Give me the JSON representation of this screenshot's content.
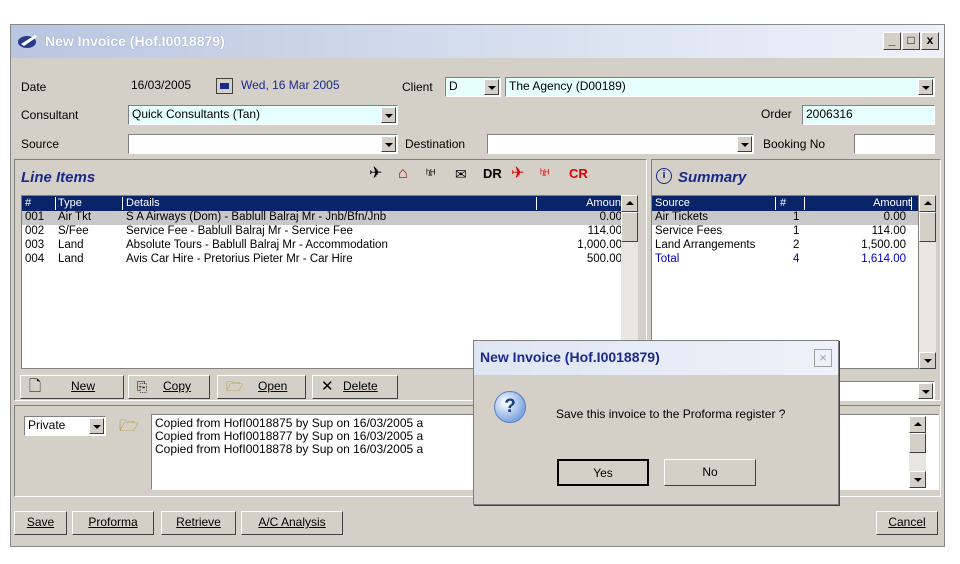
{
  "window": {
    "title": "New Invoice (Hof.I0018879)",
    "min_label": "_",
    "max_label": "□",
    "close_label": "x"
  },
  "form": {
    "date_label": "Date",
    "date_value": "16/03/2005",
    "date_long": "Wed, 16 Mar 2005",
    "client_label": "Client",
    "client_code": "D",
    "client_name": "The Agency (D00189)",
    "consultant_label": "Consultant",
    "consultant_value": "Quick Consultants (Tan)",
    "order_label": "Order",
    "order_value": "2006316",
    "source_label": "Source",
    "source_value": "",
    "destination_label": "Destination",
    "destination_value": "",
    "booking_label": "Booking No",
    "booking_value": ""
  },
  "line_items": {
    "title": "Line Items",
    "toolbar_labels": {
      "dr": "DR",
      "cr": "CR"
    },
    "columns": [
      "#",
      "Type",
      "Details",
      "Amount"
    ],
    "rows": [
      {
        "num": "001",
        "type": "Air Tkt",
        "details": "S A Airways (Dom) - Bablull Balraj Mr - Jnb/Bfn/Jnb",
        "amount": "0.00"
      },
      {
        "num": "002",
        "type": "S/Fee",
        "details": "Service Fee - Bablull Balraj Mr - Service Fee",
        "amount": "114.00"
      },
      {
        "num": "003",
        "type": "Land",
        "details": "Absolute Tours - Bablull Balraj Mr - Accommodation",
        "amount": "1,000.00"
      },
      {
        "num": "004",
        "type": "Land",
        "details": "Avis Car Hire - Pretorius Pieter Mr - Car Hire",
        "amount": "500.00"
      }
    ],
    "buttons": {
      "new": "New",
      "copy": "Copy",
      "open": "Open",
      "delete": "Delete"
    }
  },
  "summary": {
    "title": "Summary",
    "columns": [
      "Source",
      "#",
      "Amount"
    ],
    "rows": [
      {
        "source": "Air Tickets",
        "count": "1",
        "amount": "0.00"
      },
      {
        "source": "Service Fees",
        "count": "1",
        "amount": "114.00"
      },
      {
        "source": "Land Arrangements",
        "count": "2",
        "amount": "1,500.00"
      },
      {
        "source": "Total",
        "count": "4",
        "amount": "1,614.00"
      }
    ]
  },
  "notes": {
    "type_value": "Private",
    "lines": [
      "Copied from HofI0018875 by Sup on 16/03/2005 a",
      "Copied from HofI0018877 by Sup on 16/03/2005 a",
      "Copied from HofI0018878 by Sup on 16/03/2005 a"
    ]
  },
  "bottom": {
    "save": "Save",
    "proforma": "Proforma",
    "retrieve": "Retrieve",
    "ac_analysis": "A/C Analysis",
    "cancel": "Cancel"
  },
  "dialog": {
    "title": "New Invoice (Hof.I0018879)",
    "close": "×",
    "icon": "?",
    "message": "Save this invoice to the Proforma register ?",
    "yes": "Yes",
    "no": "No"
  },
  "colors": {
    "header_bg": "#0a246a",
    "title_blue": "#1a2a8a",
    "total_blue": "#0000c0",
    "field_cyan": "#e6ffff"
  }
}
